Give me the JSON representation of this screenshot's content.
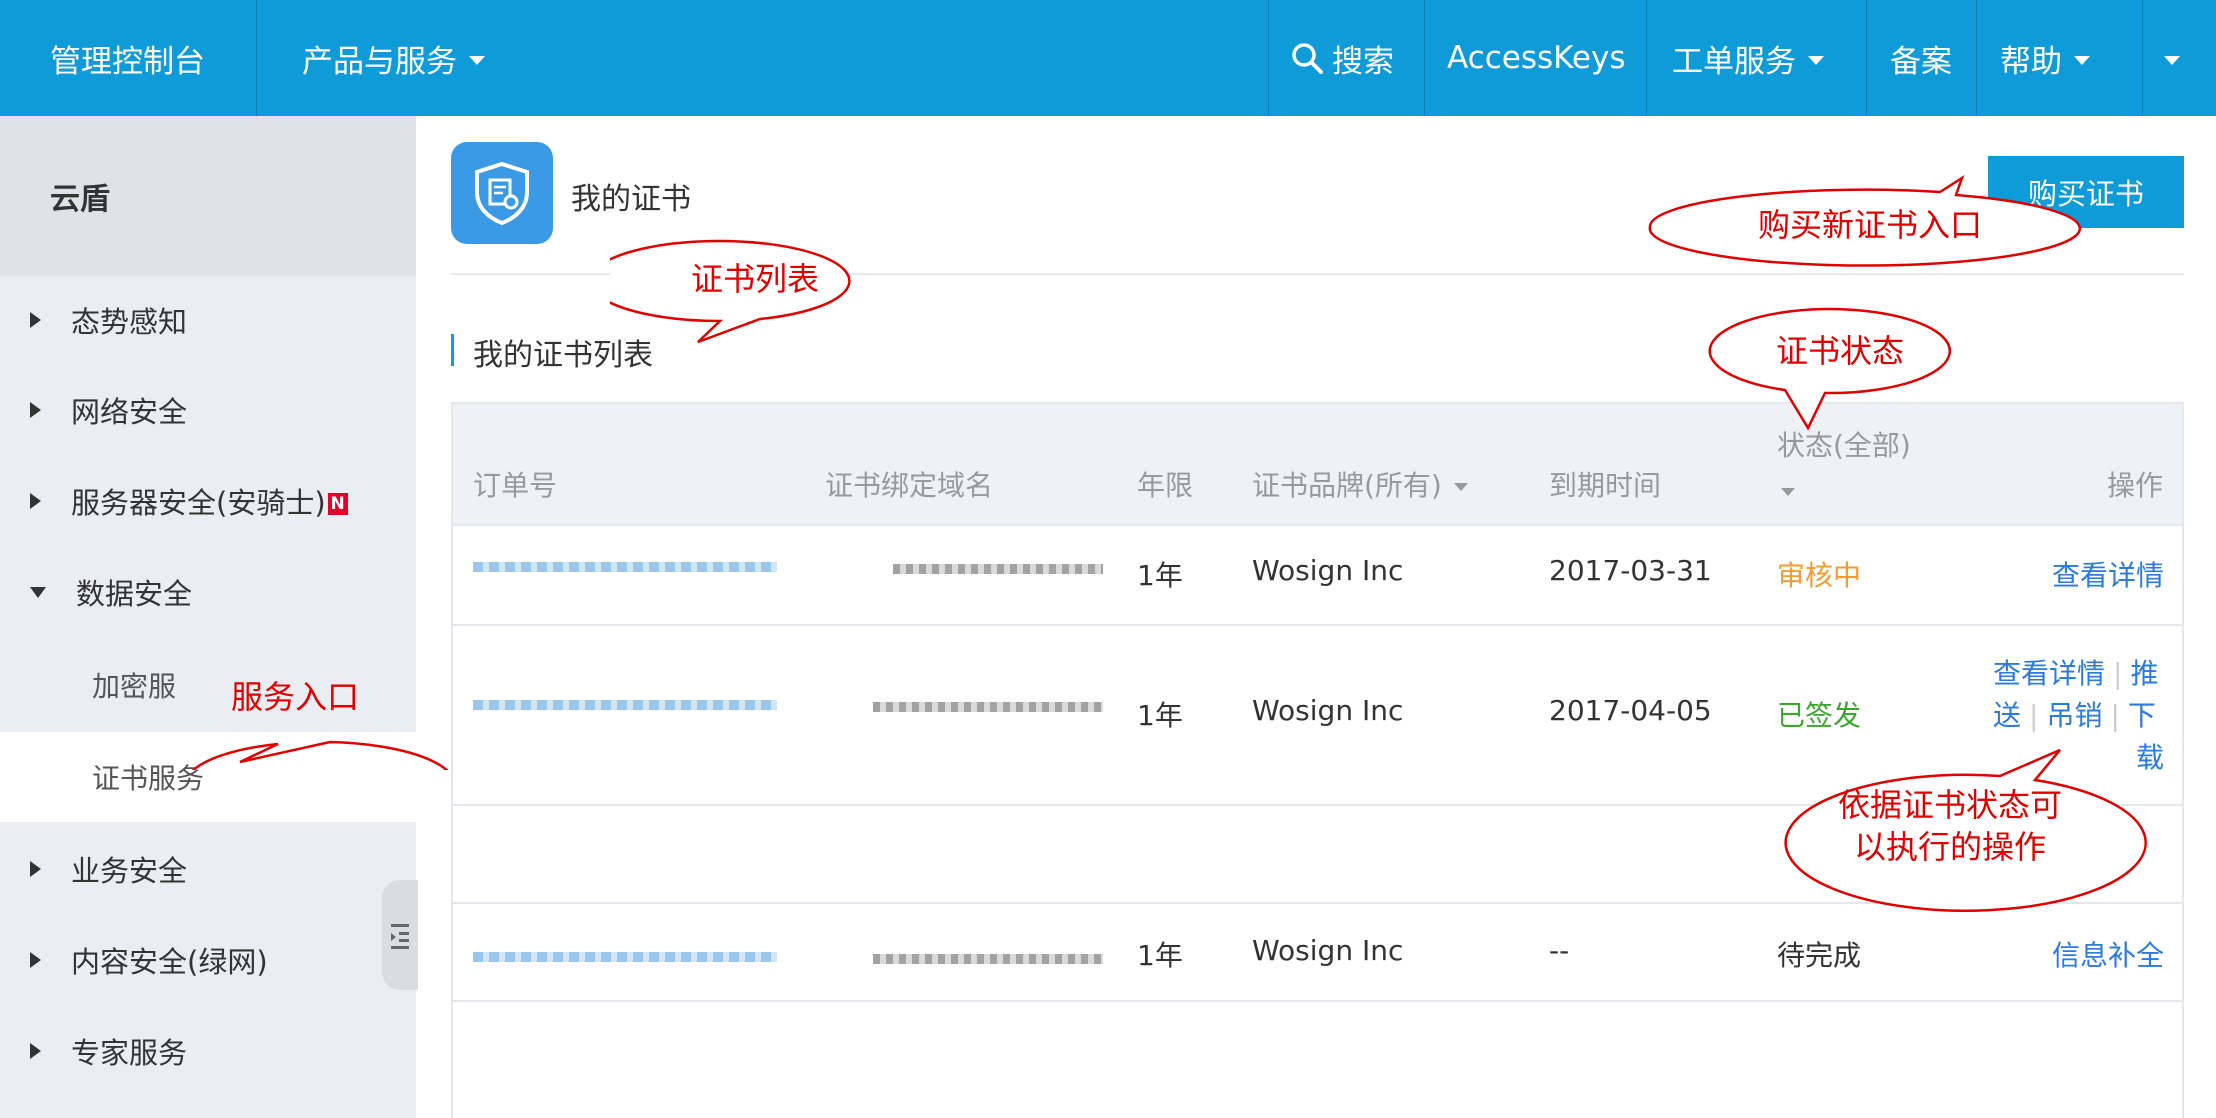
{
  "topbar": {
    "console": "管理控制台",
    "products": "产品与服务",
    "search": "搜索",
    "accesskeys": "AccessKeys",
    "tickets": "工单服务",
    "beian": "备案",
    "help": "帮助"
  },
  "sidebar": {
    "title": "云盾",
    "items": [
      {
        "label": "态势感知"
      },
      {
        "label": "网络安全"
      },
      {
        "label": "服务器安全(安骑士)",
        "badge": "N"
      },
      {
        "label": "数据安全"
      },
      {
        "label": "业务安全"
      },
      {
        "label": "内容安全(绿网)"
      },
      {
        "label": "专家服务"
      }
    ],
    "sub_items": [
      {
        "label": "加密服"
      },
      {
        "label": "证书服务"
      }
    ]
  },
  "main": {
    "title": "我的证书",
    "buy_button": "购买证书",
    "section_title": "我的证书列表",
    "table": {
      "headers": {
        "order": "订单号",
        "domain": "证书绑定域名",
        "period": "年限",
        "brand": "证书品牌(所有)",
        "expiry": "到期时间",
        "status": "状态(全部)",
        "actions": "操作"
      },
      "rows": [
        {
          "period": "1年",
          "brand": "Wosign Inc",
          "expiry": "2017-03-31",
          "status": "审核中",
          "action1": "查看详情"
        },
        {
          "period": "1年",
          "brand": "Wosign Inc",
          "expiry": "2017-04-05",
          "status": "已签发",
          "action1": "查看详情",
          "action2": "推",
          "action3": "送",
          "action4": "吊销",
          "action5": "下",
          "action6": "载"
        },
        {
          "period": "1年",
          "brand": "Wosign Inc",
          "expiry": "--",
          "status": "待完成",
          "action1": "信息补全"
        }
      ]
    }
  },
  "annotations": {
    "buy_entry": "购买新证书入口",
    "cert_list": "证书列表",
    "cert_status": "证书状态",
    "service_entry": "服务入口",
    "ops_line1": "依据证书状态可",
    "ops_line2": "以执行的操作"
  },
  "colors": {
    "topbar": "#0f9bd7",
    "link": "#2a7ae2",
    "pending": "#f39c33",
    "issued": "#3ba62c",
    "annotation": "#e00000"
  }
}
